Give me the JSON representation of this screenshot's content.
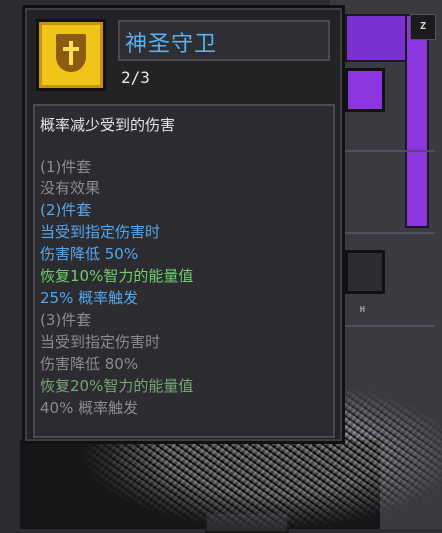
{
  "item": {
    "name": "神圣守卫",
    "count": "2/3",
    "icon": "holy-shield-icon",
    "description": "概率减少受到的伤害"
  },
  "set_bonuses": [
    {
      "lines": [
        "(1)件套",
        "没有效果"
      ]
    },
    {
      "lines": [
        "(2)件套",
        "当受到指定伤害时",
        "伤害降低 50%",
        "恢复10%智力的能量值",
        "25% 概率触发"
      ]
    },
    {
      "lines": [
        "(3)件套",
        "当受到指定伤害时",
        "伤害降低 80%",
        "恢复20%智力的能量值",
        "40% 概率触发"
      ]
    }
  ],
  "hotkeys": {
    "z": "Z",
    "h": "H"
  },
  "colors": {
    "name": "#5ab0f0",
    "active": "#52a8f0",
    "inactive": "#8c8c8c",
    "energy": "#6dd06d",
    "icon_bg": "#f2c318"
  }
}
